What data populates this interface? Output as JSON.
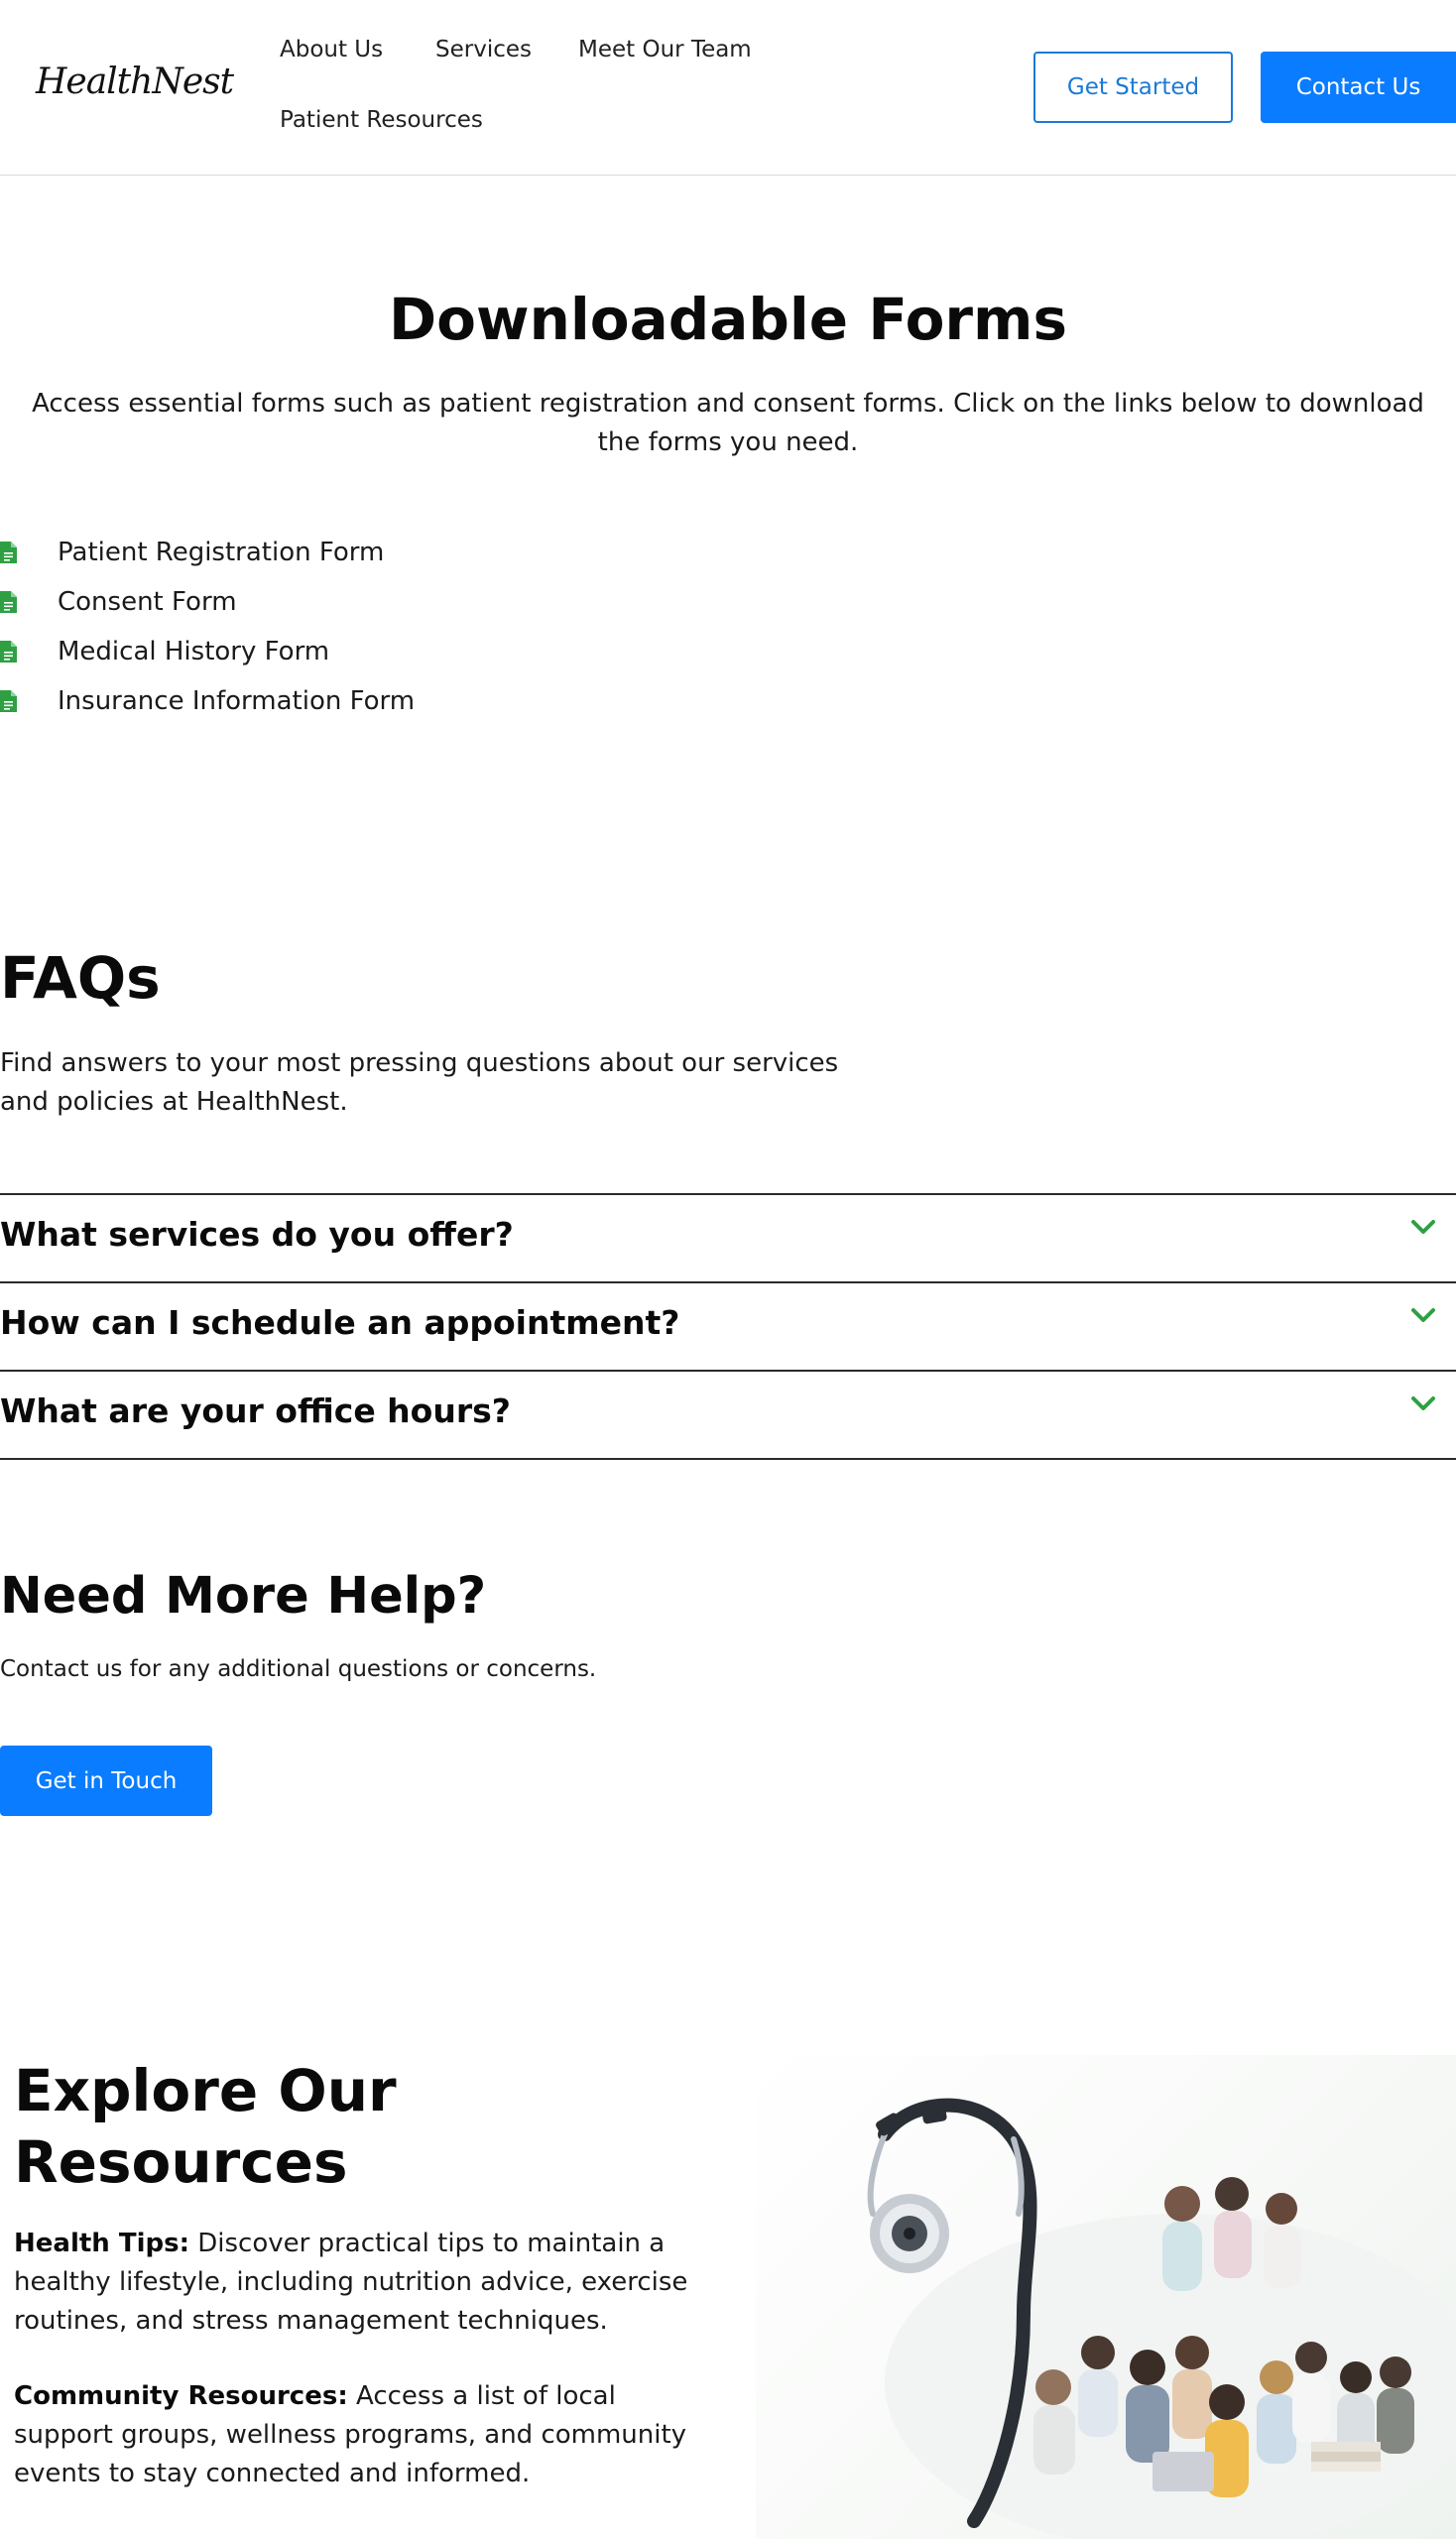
{
  "header": {
    "logo": "HealthNest",
    "nav": [
      "About Us",
      "Services",
      "Meet Our Team",
      "Patient Resources"
    ],
    "get_started": "Get Started",
    "contact_us": "Contact Us"
  },
  "forms": {
    "title": "Downloadable Forms",
    "description": "Access essential forms such as patient registration and consent forms. Click on the links below to download the forms you need.",
    "items": [
      "Patient Registration Form",
      "Consent Form",
      "Medical History Form",
      "Insurance Information Form"
    ],
    "icon": "file-icon"
  },
  "faqs": {
    "title": "FAQs",
    "description": "Find answers to your most pressing questions about our services and policies at HealthNest.",
    "items": [
      "What services do you offer?",
      "How can I schedule an appointment?",
      "What are your office hours?"
    ],
    "icon": "chevron-down-icon"
  },
  "help": {
    "title": "Need More Help?",
    "description": "Contact us for any additional questions or concerns.",
    "button": "Get in Touch"
  },
  "resources": {
    "title": "Explore Our Resources",
    "items": [
      {
        "label": "Health Tips:",
        "text": " Discover practical tips to maintain a healthy lifestyle, including nutrition advice, exercise routines, and stress management techniques."
      },
      {
        "label": "Community Resources:",
        "text": " Access a list of local support groups, wellness programs, and community events to stay connected and informed."
      }
    ],
    "image": "stethoscope-and-community-group-image"
  },
  "colors": {
    "primary": "#0a7cff",
    "outline": "#1c7ad6",
    "icon_green": "#2ea043"
  }
}
